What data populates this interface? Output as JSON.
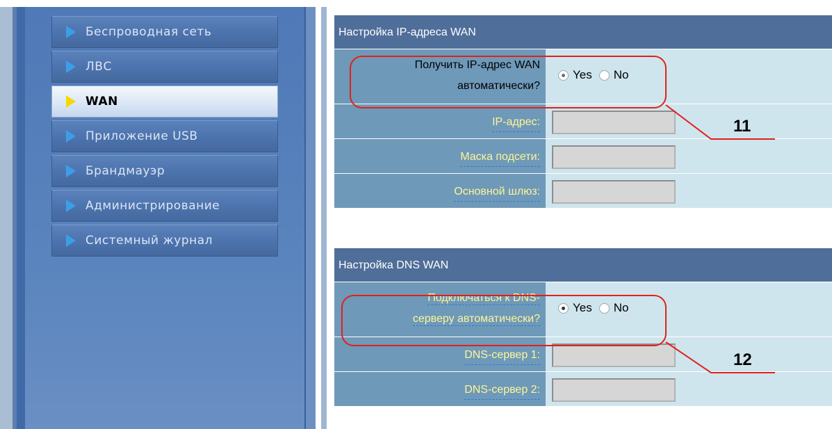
{
  "sidebar": {
    "items": [
      {
        "label": "Беспроводная сеть",
        "active": false
      },
      {
        "label": "ЛВС",
        "active": false
      },
      {
        "label": "WAN",
        "active": true
      },
      {
        "label": "Приложение USB",
        "active": false
      },
      {
        "label": "Брандмауэр",
        "active": false
      },
      {
        "label": "Администрирование",
        "active": false
      },
      {
        "label": "Системный журнал",
        "active": false
      }
    ]
  },
  "wan_ip": {
    "header": "Настройка IP-адреса WAN",
    "auto_label_line1": "Получить IP-адрес WAN",
    "auto_label_line2": "автоматически?",
    "yes_label": "Yes",
    "no_label": "No",
    "selected": "Yes",
    "ip_label": "IP-адрес:",
    "ip_value": "",
    "mask_label": "Маска подсети:",
    "mask_value": "",
    "gateway_label": "Основной шлюз:",
    "gateway_value": ""
  },
  "wan_dns": {
    "header": "Настройка DNS WAN",
    "auto_label_line1": "Подключаться к DNS-",
    "auto_label_line2": "серверу автоматически?",
    "yes_label": "Yes",
    "no_label": "No",
    "selected": "Yes",
    "dns1_label": "DNS-сервер 1:",
    "dns1_value": "",
    "dns2_label": "DNS-сервер 2:",
    "dns2_value": ""
  },
  "annotations": {
    "callout_1": "11",
    "callout_2": "12",
    "color": "#e0201b"
  },
  "colors": {
    "header_bg": "#4f6e99",
    "label_bg": "#6f99b8",
    "value_bg": "#cfe5ed",
    "sidebar_bg": "#4f79b7",
    "active_arrow": "#f5d800",
    "inactive_arrow": "#3d9ee8"
  }
}
